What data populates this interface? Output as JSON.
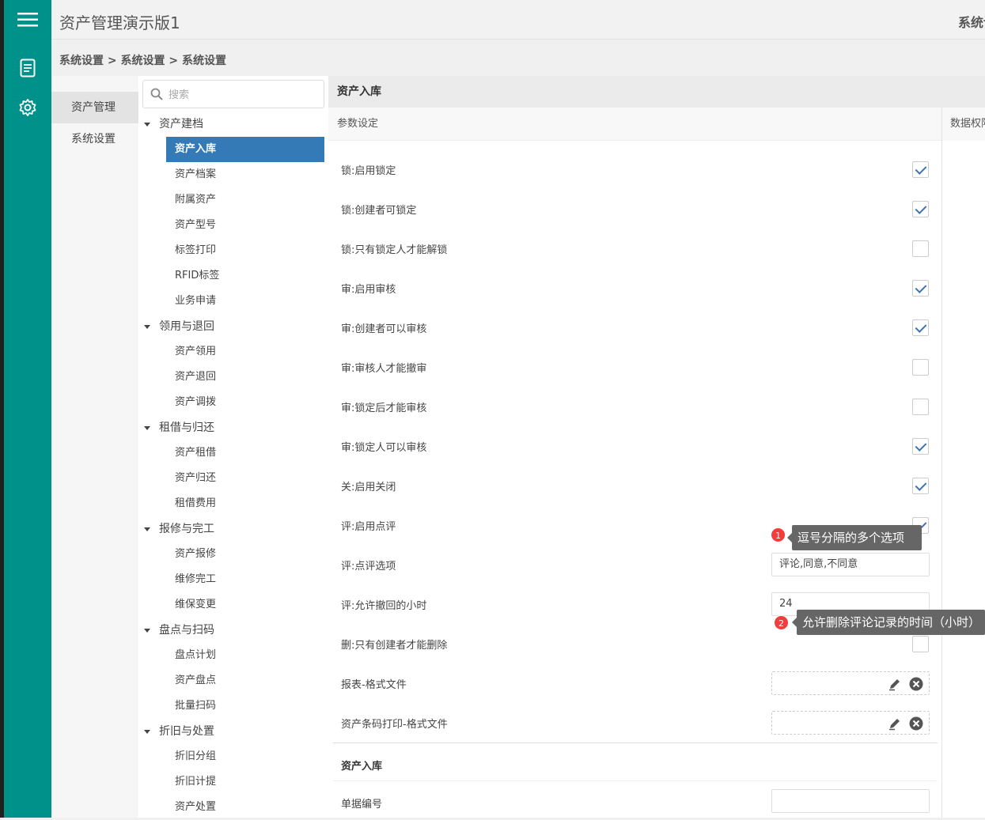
{
  "app": {
    "title": "资产管理演示版1",
    "top_right": "系统设"
  },
  "breadcrumb": "系统设置 > 系统设置 > 系统设置",
  "icons": {
    "menu": "hamburger-icon",
    "doc": "document-icon",
    "settings": "gear-icon"
  },
  "modules": [
    {
      "label": "资产管理",
      "active": true
    },
    {
      "label": "系统设置",
      "active": false
    }
  ],
  "search": {
    "placeholder": "搜索"
  },
  "tree": [
    {
      "label": "资产建档",
      "children": [
        "资产入库",
        "资产档案",
        "附属资产",
        "资产型号",
        "标签打印",
        "RFID标签",
        "业务申请"
      ]
    },
    {
      "label": "领用与退回",
      "children": [
        "资产领用",
        "资产退回",
        "资产调拨"
      ]
    },
    {
      "label": "租借与归还",
      "children": [
        "资产租借",
        "资产归还",
        "租借费用"
      ]
    },
    {
      "label": "报修与完工",
      "children": [
        "资产报修",
        "维修完工",
        "维保变更"
      ]
    },
    {
      "label": "盘点与扫码",
      "children": [
        "盘点计划",
        "资产盘点",
        "批量扫码"
      ]
    },
    {
      "label": "折旧与处置",
      "children": [
        "折旧分组",
        "折旧计提",
        "资产处置"
      ]
    }
  ],
  "tree_active": "资产入库",
  "main": {
    "title": "资产入库",
    "sub_title": "参数设定",
    "right_tab": "数据权限",
    "rows": [
      {
        "label": "锁:启用锁定",
        "type": "check",
        "checked": true
      },
      {
        "label": "锁:创建者可锁定",
        "type": "check",
        "checked": true
      },
      {
        "label": "锁:只有锁定人才能解锁",
        "type": "check",
        "checked": false
      },
      {
        "label": "审:启用审核",
        "type": "check",
        "checked": true
      },
      {
        "label": "审:创建者可以审核",
        "type": "check",
        "checked": true
      },
      {
        "label": "审:审核人才能撤审",
        "type": "check",
        "checked": false
      },
      {
        "label": "审:锁定后才能审核",
        "type": "check",
        "checked": false
      },
      {
        "label": "审:锁定人可以审核",
        "type": "check",
        "checked": true
      },
      {
        "label": "关:启用关闭",
        "type": "check",
        "checked": true
      },
      {
        "label": "评:启用点评",
        "type": "check",
        "checked": true
      },
      {
        "label": "评:点评选项",
        "type": "text",
        "value": "评论,同意,不同意"
      },
      {
        "label": "评:允许撤回的小时",
        "type": "text",
        "value": "24"
      },
      {
        "label": "删:只有创建者才能删除",
        "type": "check",
        "checked": false
      },
      {
        "label": "报表-格式文件",
        "type": "file"
      },
      {
        "label": "资产条码打印-格式文件",
        "type": "file"
      }
    ],
    "section2": {
      "title": "资产入库",
      "field_label": "单据编号",
      "field_value": ""
    }
  },
  "tooltips": [
    {
      "num": "1",
      "text": "逗号分隔的多个选项"
    },
    {
      "num": "2",
      "text": "允许删除评论记录的时间（小时）"
    }
  ]
}
